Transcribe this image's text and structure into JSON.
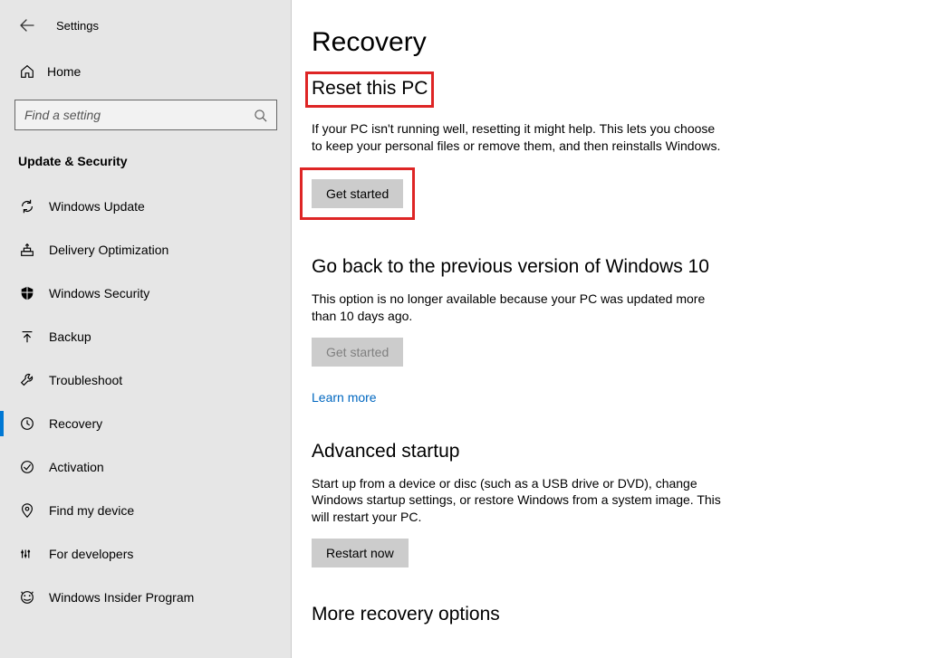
{
  "app": {
    "title": "Settings"
  },
  "sidebar": {
    "home_label": "Home",
    "search_placeholder": "Find a setting",
    "category_title": "Update & Security",
    "items": [
      {
        "icon": "sync",
        "label": "Windows Update"
      },
      {
        "icon": "delivery",
        "label": "Delivery Optimization"
      },
      {
        "icon": "shield",
        "label": "Windows Security"
      },
      {
        "icon": "backup",
        "label": "Backup"
      },
      {
        "icon": "troubleshoot",
        "label": "Troubleshoot"
      },
      {
        "icon": "recovery",
        "label": "Recovery"
      },
      {
        "icon": "activation",
        "label": "Activation"
      },
      {
        "icon": "findmydevice",
        "label": "Find my device"
      },
      {
        "icon": "developers",
        "label": "For developers"
      },
      {
        "icon": "insider",
        "label": "Windows Insider Program"
      }
    ],
    "selected_index": 5
  },
  "main": {
    "page_title": "Recovery",
    "sections": {
      "reset": {
        "title": "Reset this PC",
        "desc": "If your PC isn't running well, resetting it might help. This lets you choose to keep your personal files or remove them, and then reinstalls Windows.",
        "button": "Get started"
      },
      "goback": {
        "title": "Go back to the previous version of Windows 10",
        "desc": "This option is no longer available because your PC was updated more than 10 days ago.",
        "button": "Get started",
        "learn_more": "Learn more"
      },
      "advanced": {
        "title": "Advanced startup",
        "desc": "Start up from a device or disc (such as a USB drive or DVD), change Windows startup settings, or restore Windows from a system image. This will restart your PC.",
        "button": "Restart now"
      },
      "more": {
        "title": "More recovery options"
      }
    }
  }
}
